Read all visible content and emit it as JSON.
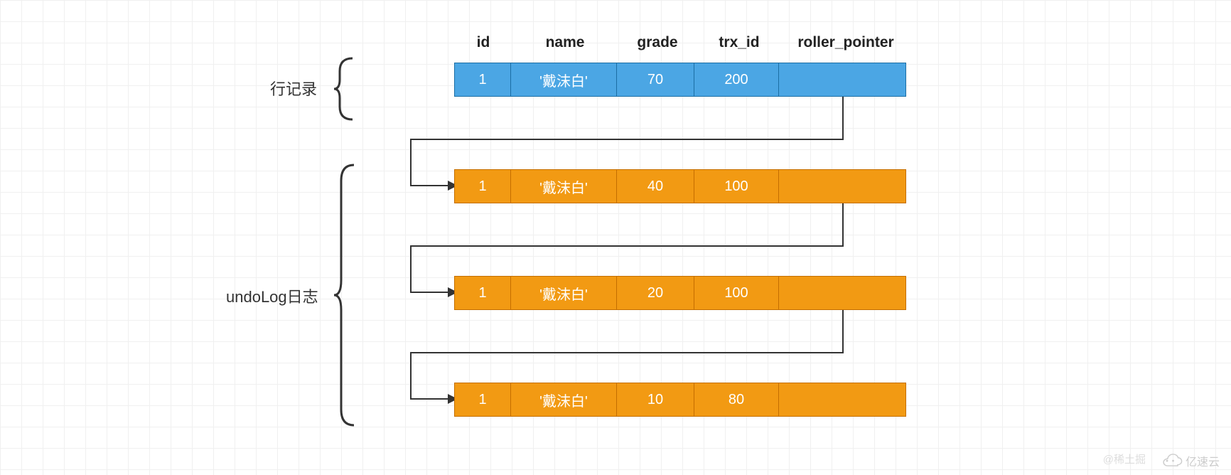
{
  "labels": {
    "rowRecord": "行记录",
    "undoLog": "undoLog日志"
  },
  "headers": {
    "id": "id",
    "name": "name",
    "grade": "grade",
    "trx_id": "trx_id",
    "roller_pointer": "roller_pointer"
  },
  "rows": [
    {
      "id": "1",
      "name": "'戴沫白'",
      "grade": "70",
      "trx_id": "200",
      "ptr": ""
    },
    {
      "id": "1",
      "name": "'戴沫白'",
      "grade": "40",
      "trx_id": "100",
      "ptr": ""
    },
    {
      "id": "1",
      "name": "'戴沫白'",
      "grade": "20",
      "trx_id": "100",
      "ptr": ""
    },
    {
      "id": "1",
      "name": "'戴沫白'",
      "grade": "10",
      "trx_id": "80",
      "ptr": ""
    }
  ],
  "watermark": {
    "left": "@稀土掘",
    "right": "亿速云"
  },
  "colors": {
    "blue": "#4ba6e4",
    "orange": "#f29a13",
    "gridline": "#f0f0f0"
  }
}
